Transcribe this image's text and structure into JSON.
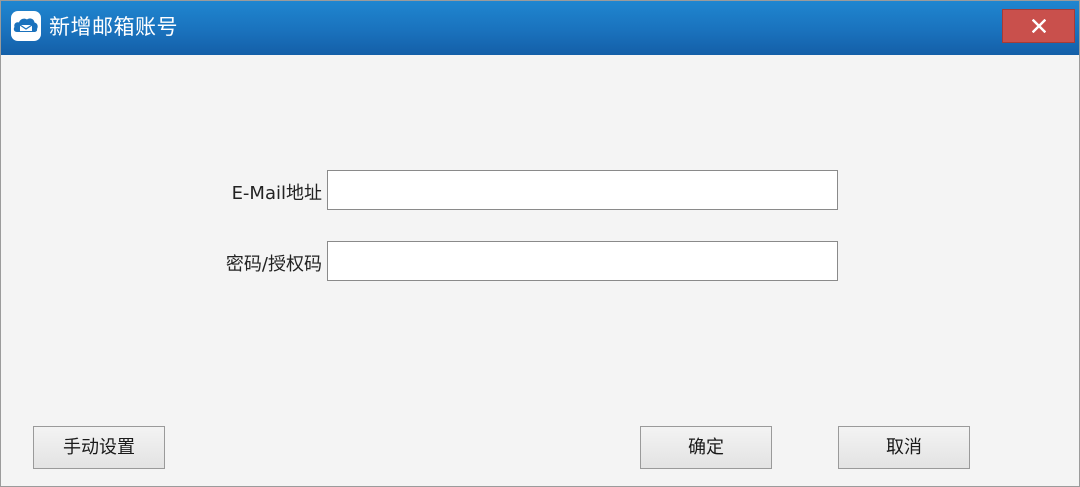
{
  "window": {
    "title": "新增邮箱账号",
    "app_icon": "mail-app-icon",
    "close_icon": "close-icon"
  },
  "form": {
    "email_label": "E-Mail地址",
    "email_value": "",
    "password_label": "密码/授权码",
    "password_value": ""
  },
  "buttons": {
    "manual_settings": "手动设置",
    "confirm": "确定",
    "cancel": "取消"
  },
  "colors": {
    "titlebar": "#1a72bd",
    "close_button": "#c9504c",
    "background": "#f4f4f4"
  }
}
